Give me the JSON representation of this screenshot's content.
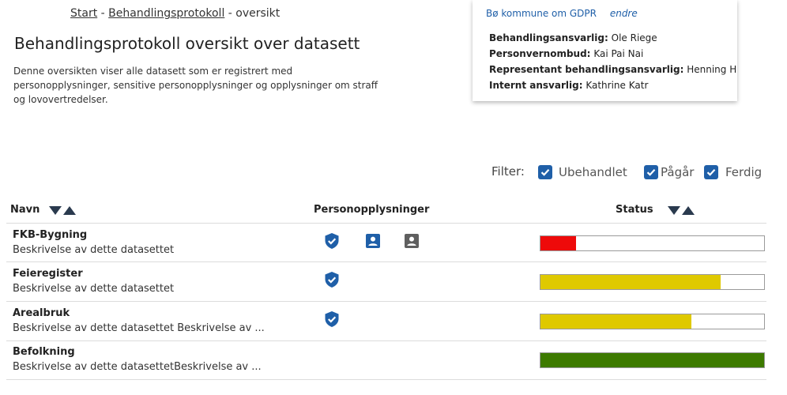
{
  "breadcrumb": {
    "start": "Start",
    "sep": " - ",
    "protocol": "Behandlingsprotokoll",
    "current": "oversikt"
  },
  "page": {
    "title": "Behandlingsprotokoll oversikt over datasett",
    "description": "Denne oversikten viser alle datasett som er registrert med personopplysninger, sensitive personopplysninger og opplysninger om straff og lovovertredelser."
  },
  "gdpr": {
    "title": "Bø kommune om GDPR",
    "edit": "endre",
    "items": [
      {
        "label": "Behandlingsansvarlig:",
        "value": "Ole Riege"
      },
      {
        "label": "Personvernombud:",
        "value": "Kai Pai Nai"
      },
      {
        "label": "Representant behandlingsansvarlig:",
        "value": "Henning H"
      },
      {
        "label": "Internt ansvarlig:",
        "value": "Kathrine Katr"
      }
    ]
  },
  "filter": {
    "label": "Filter:",
    "options": [
      {
        "label": "Ubehandlet",
        "checked": true
      },
      {
        "label": "Pågår",
        "checked": true
      },
      {
        "label": "Ferdig",
        "checked": true
      }
    ]
  },
  "table": {
    "headers": {
      "name": "Navn",
      "personal": "Personopplysninger",
      "status": "Status"
    },
    "rows": [
      {
        "name": "FKB-Bygning",
        "description": "Beskrivelse av dette datasettet",
        "icons": [
          "shield-icon",
          "person-blue-icon",
          "person-gray-icon"
        ],
        "status": {
          "progress": 0.16,
          "color": "#ee0a0a"
        }
      },
      {
        "name": "Feieregister",
        "description": "Beskrivelse av dette datasettet",
        "icons": [
          "shield-icon"
        ],
        "status": {
          "progress": 0.805,
          "color": "#dfc900"
        }
      },
      {
        "name": "Arealbruk",
        "description": "Beskrivelse av dette datasettet Beskrivelse av ...",
        "icons": [
          "shield-icon"
        ],
        "status": {
          "progress": 0.675,
          "color": "#dfc900"
        }
      },
      {
        "name": "Befolkning",
        "description": "Beskrivelse av dette datasettetBeskrivelse av ...",
        "icons": [],
        "status": {
          "progress": 1.0,
          "color": "#3d7a00"
        }
      }
    ]
  },
  "colors": {
    "accent": "#1f5fa8",
    "red": "#ee0a0a",
    "yellow": "#dfc900",
    "green": "#3d7a00",
    "gray_icon": "#5f5f5f"
  }
}
